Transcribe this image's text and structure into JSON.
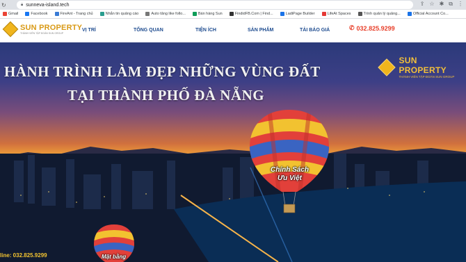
{
  "browser": {
    "url": "sunneva-island.tech",
    "bookmarks": [
      {
        "label": "Gmail",
        "color": "#ea4335"
      },
      {
        "label": "Facebook",
        "color": "#1877f2"
      },
      {
        "label": "FireAnt - Trang chủ",
        "color": "#3a7bd5"
      },
      {
        "label": "Nhắn tin quảng cáo",
        "color": "#2a9d8f"
      },
      {
        "label": "Auto tăng like follo...",
        "color": "#777777"
      },
      {
        "label": "Bán hàng Sun",
        "color": "#0f9d58"
      },
      {
        "label": "FindidFB.Com | Find...",
        "color": "#333333"
      },
      {
        "label": "LadiPage Builder",
        "color": "#1a73e8"
      },
      {
        "label": "LifeAt Spaces",
        "color": "#e53935"
      },
      {
        "label": "Trình quản lý quảng...",
        "color": "#555555"
      },
      {
        "label": "Official Account Co...",
        "color": "#1a73e8"
      }
    ]
  },
  "header": {
    "logo_text": "SUN PROPERTY",
    "logo_sub": "THÀNH VIÊN TẬP ĐOÀN SUN GROUP",
    "menu": [
      "VỊ TRÍ",
      "TỔNG QUAN",
      "TIỆN ÍCH",
      "SẢN PHẨM",
      "TẢI BÁO GIÁ"
    ],
    "phone": "032.825.9299"
  },
  "hero": {
    "title_line1": "HÀNH TRÌNH LÀM ĐẸP NHỮNG VÙNG ĐẤT",
    "title_line2": "TẠI THÀNH PHỐ ĐÀ NẴNG",
    "logo_name": "SUN PROPERTY",
    "logo_sub": "THÀNH VIÊN TẬP ĐOÀN SUN GROUP",
    "balloon1_line1": "Chính Sách",
    "balloon1_line2": "Ưu Việt",
    "balloon2_label": "Mặt bằng",
    "hotline": "line: 032.825.9299"
  },
  "colors": {
    "menu": "#1d4b8f",
    "phone": "#e8402b",
    "brand_gold": "#f0b51d"
  }
}
